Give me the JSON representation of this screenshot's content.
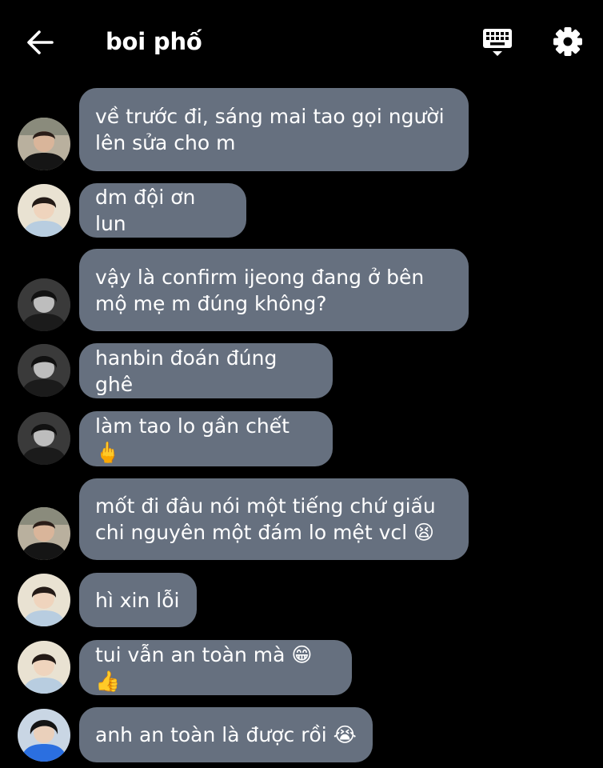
{
  "header": {
    "title": "boi phố",
    "back_icon": "arrow-left-icon",
    "keyboard_icon": "keyboard-icon",
    "settings_icon": "gear-icon"
  },
  "colors": {
    "background": "#000000",
    "bubble": "#66707f",
    "text": "#ffffff"
  },
  "messages": [
    {
      "avatar": "person-a",
      "text": "về trước đi, sáng mai tao gọi người\nlên sửa cho m"
    },
    {
      "avatar": "person-b",
      "text": "dm đội ơn lun"
    },
    {
      "avatar": "person-c",
      "text": "vậy là confirm ijeong đang ở bên\nmộ mẹ m đúng không?"
    },
    {
      "avatar": "person-c",
      "text": "hanbin đoán đúng ghê"
    },
    {
      "avatar": "person-c",
      "text": "làm tao lo gần chết 🖕"
    },
    {
      "avatar": "person-a",
      "text": "mốt đi đâu nói một tiếng chứ giấu\nchi nguyên một đám lo mệt vcl 😫"
    },
    {
      "avatar": "person-b",
      "text": "hì xin lỗi"
    },
    {
      "avatar": "person-b",
      "text": "tui vẫn an toàn mà 😁👍"
    },
    {
      "avatar": "person-d",
      "text": "anh an toàn là được rồi 😭"
    }
  ]
}
